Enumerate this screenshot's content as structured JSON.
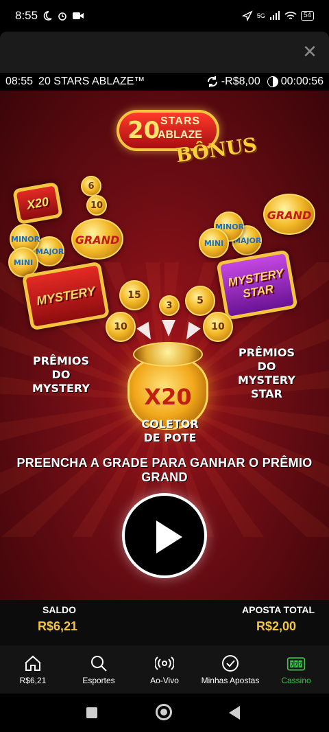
{
  "status_bar": {
    "time": "8:55",
    "battery": "54",
    "network": "5G"
  },
  "game_bar": {
    "time": "08:55",
    "game_title": "20 STARS ABLAZE™",
    "spin_amount": "-R$8,00",
    "timer": "00:00:56"
  },
  "game": {
    "logo_number": "20",
    "logo_line1": "STARS",
    "logo_line2": "ABLAZE",
    "logo_bonus": "BÔNUS",
    "left_coins": [
      "GRAND",
      "MAJOR",
      "MINOR",
      "MINI"
    ],
    "left_card": "MYSTERY",
    "left_small_card": "X20",
    "left_small_coins": [
      "6",
      "10"
    ],
    "right_coins": [
      "GRAND",
      "MAJOR",
      "MINOR",
      "MINI"
    ],
    "right_card": "MYSTERY STAR",
    "center_coins": [
      "15",
      "3",
      "5",
      "10",
      "10"
    ],
    "pot_multiplier": "X20",
    "label_mystery": "PRÊMIOS DO MYSTERY",
    "label_mystery_star": "PRÊMIOS DO MYSTERY STAR",
    "label_collector": "COLETOR DE POTE",
    "instruction": "PREENCHA A GRADE PARA GANHAR O PRÊMIO GRAND"
  },
  "balance": {
    "saldo_label": "SALDO",
    "saldo_value": "R$6,21",
    "aposta_label": "APOSTA TOTAL",
    "aposta_value": "R$2,00"
  },
  "nav": {
    "items": [
      {
        "label": "R$6,21",
        "icon": "home-icon"
      },
      {
        "label": "Esportes",
        "icon": "search-icon"
      },
      {
        "label": "Ao-Vivo",
        "icon": "live-icon"
      },
      {
        "label": "Minhas Apostas",
        "icon": "check-circle-icon"
      },
      {
        "label": "Cassino",
        "icon": "slot-icon"
      }
    ],
    "active_color": "#3ac24a"
  }
}
